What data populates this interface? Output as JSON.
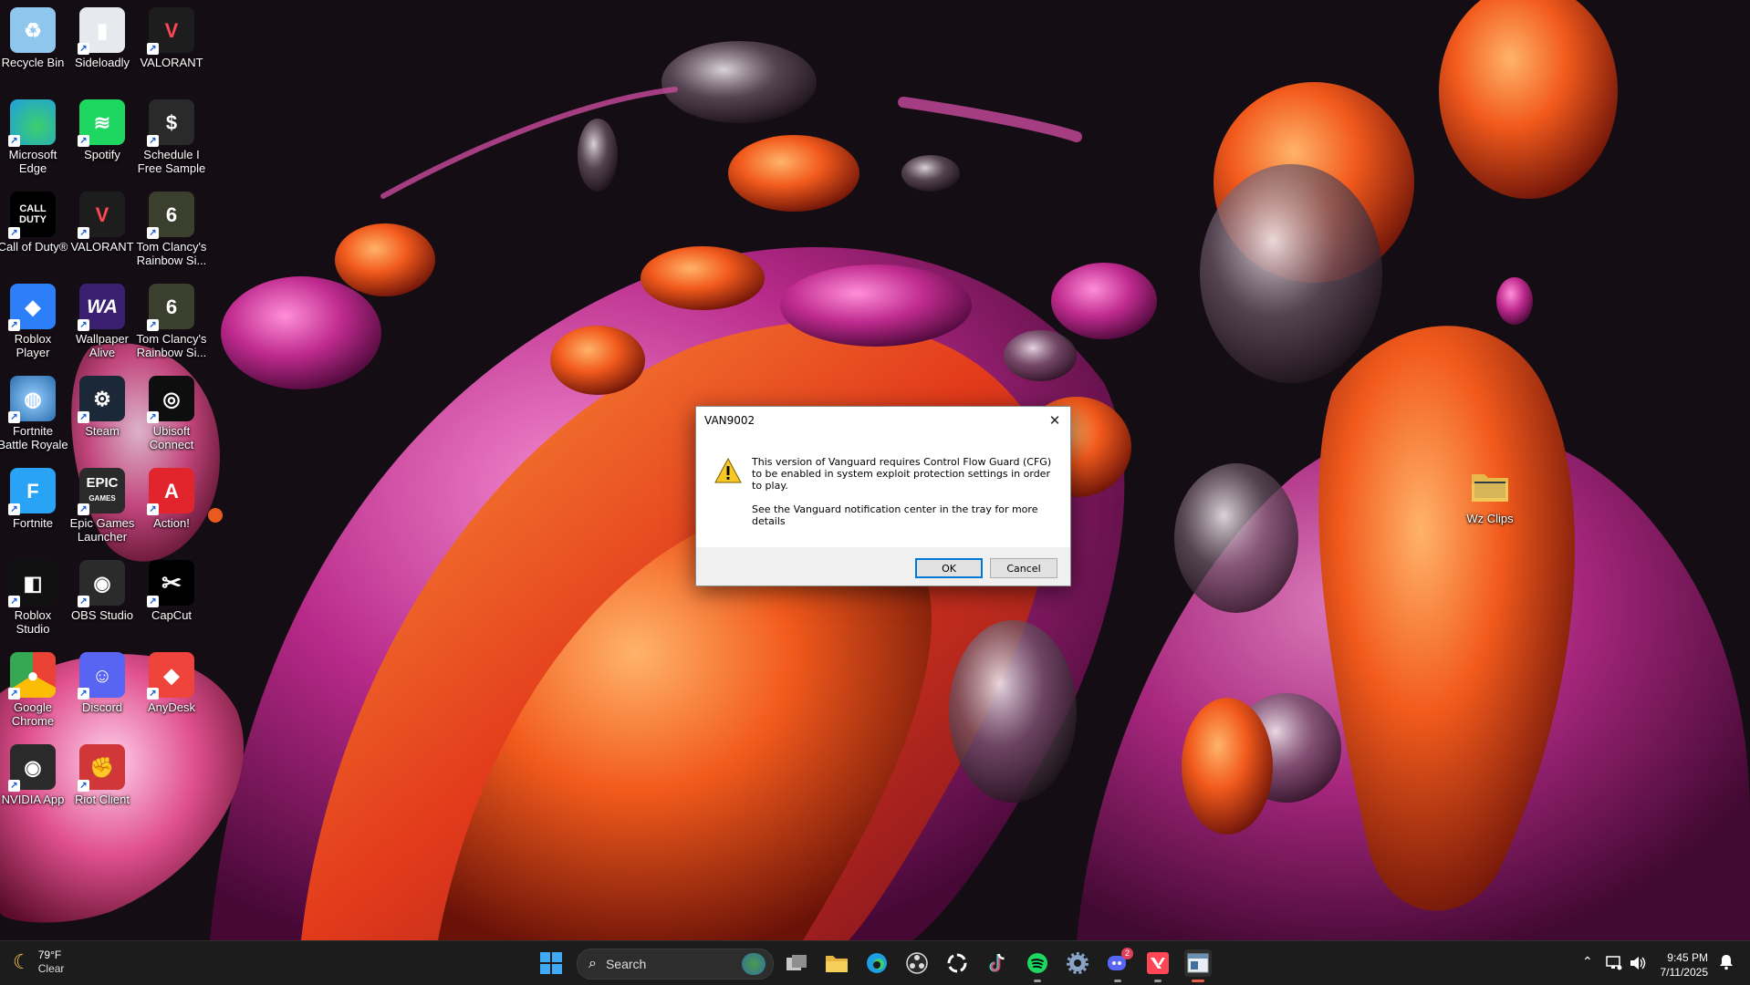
{
  "desktop": {
    "icons": [
      {
        "label": "Recycle Bin",
        "icon": "recycle-bin-icon"
      },
      {
        "label": "Sideloadly",
        "icon": "sideloadly-icon"
      },
      {
        "label": "VALORANT",
        "icon": "valorant-icon"
      },
      {
        "label": "Microsoft Edge",
        "icon": "edge-icon"
      },
      {
        "label": "Spotify",
        "icon": "spotify-icon"
      },
      {
        "label": "Schedule I Free Sample",
        "icon": "schedule-i-icon"
      },
      {
        "label": "Call of Duty®",
        "icon": "call-of-duty-icon"
      },
      {
        "label": "VALORANT",
        "icon": "valorant-icon"
      },
      {
        "label": "Tom Clancy's Rainbow Si...",
        "icon": "rainbow-six-icon"
      },
      {
        "label": "Roblox Player",
        "icon": "roblox-icon"
      },
      {
        "label": "Wallpaper Alive",
        "icon": "wallpaper-alive-icon"
      },
      {
        "label": "Tom Clancy's Rainbow Si...",
        "icon": "rainbow-six-icon"
      },
      {
        "label": "Fortnite Battle Royale",
        "icon": "fortnite-br-icon"
      },
      {
        "label": "Steam",
        "icon": "steam-icon"
      },
      {
        "label": "Ubisoft Connect",
        "icon": "ubisoft-icon"
      },
      {
        "label": "Fortnite",
        "icon": "fortnite-icon"
      },
      {
        "label": "Epic Games Launcher",
        "icon": "epic-games-icon"
      },
      {
        "label": "Action!",
        "icon": "action-icon"
      },
      {
        "label": "Roblox Studio",
        "icon": "roblox-studio-icon"
      },
      {
        "label": "OBS Studio",
        "icon": "obs-icon"
      },
      {
        "label": "CapCut",
        "icon": "capcut-icon"
      },
      {
        "label": "Google Chrome",
        "icon": "chrome-icon"
      },
      {
        "label": "Discord",
        "icon": "discord-icon"
      },
      {
        "label": "AnyDesk",
        "icon": "anydesk-icon"
      },
      {
        "label": "NVIDIA App",
        "icon": "nvidia-icon"
      },
      {
        "label": "Riot Client",
        "icon": "riot-client-icon"
      },
      {
        "label": "Wz Clips",
        "icon": "folder-icon"
      }
    ],
    "tile_text": {
      "epic": "EPIC",
      "epic_sub": "GAMES",
      "wa": "WA",
      "cod": "CALL DUTY",
      "capcut": "✂"
    }
  },
  "dialog": {
    "title": "VAN9002",
    "close_label": "✕",
    "message_1": "This version of Vanguard requires Control Flow Guard (CFG) to be enabled in system exploit protection settings in order to play.",
    "message_2": "See the Vanguard notification center in the tray for more details",
    "ok_label": "OK",
    "cancel_label": "Cancel"
  },
  "taskbar": {
    "weather_temp": "79°F",
    "weather_cond": "Clear",
    "search_placeholder": "Search",
    "discord_badge": "2",
    "time": "9:45 PM",
    "date": "7/11/2025"
  },
  "colors": {
    "accent": "#0078d7",
    "taskbar_bg": "#1c1c1c",
    "valorant_red": "#ff4655"
  }
}
